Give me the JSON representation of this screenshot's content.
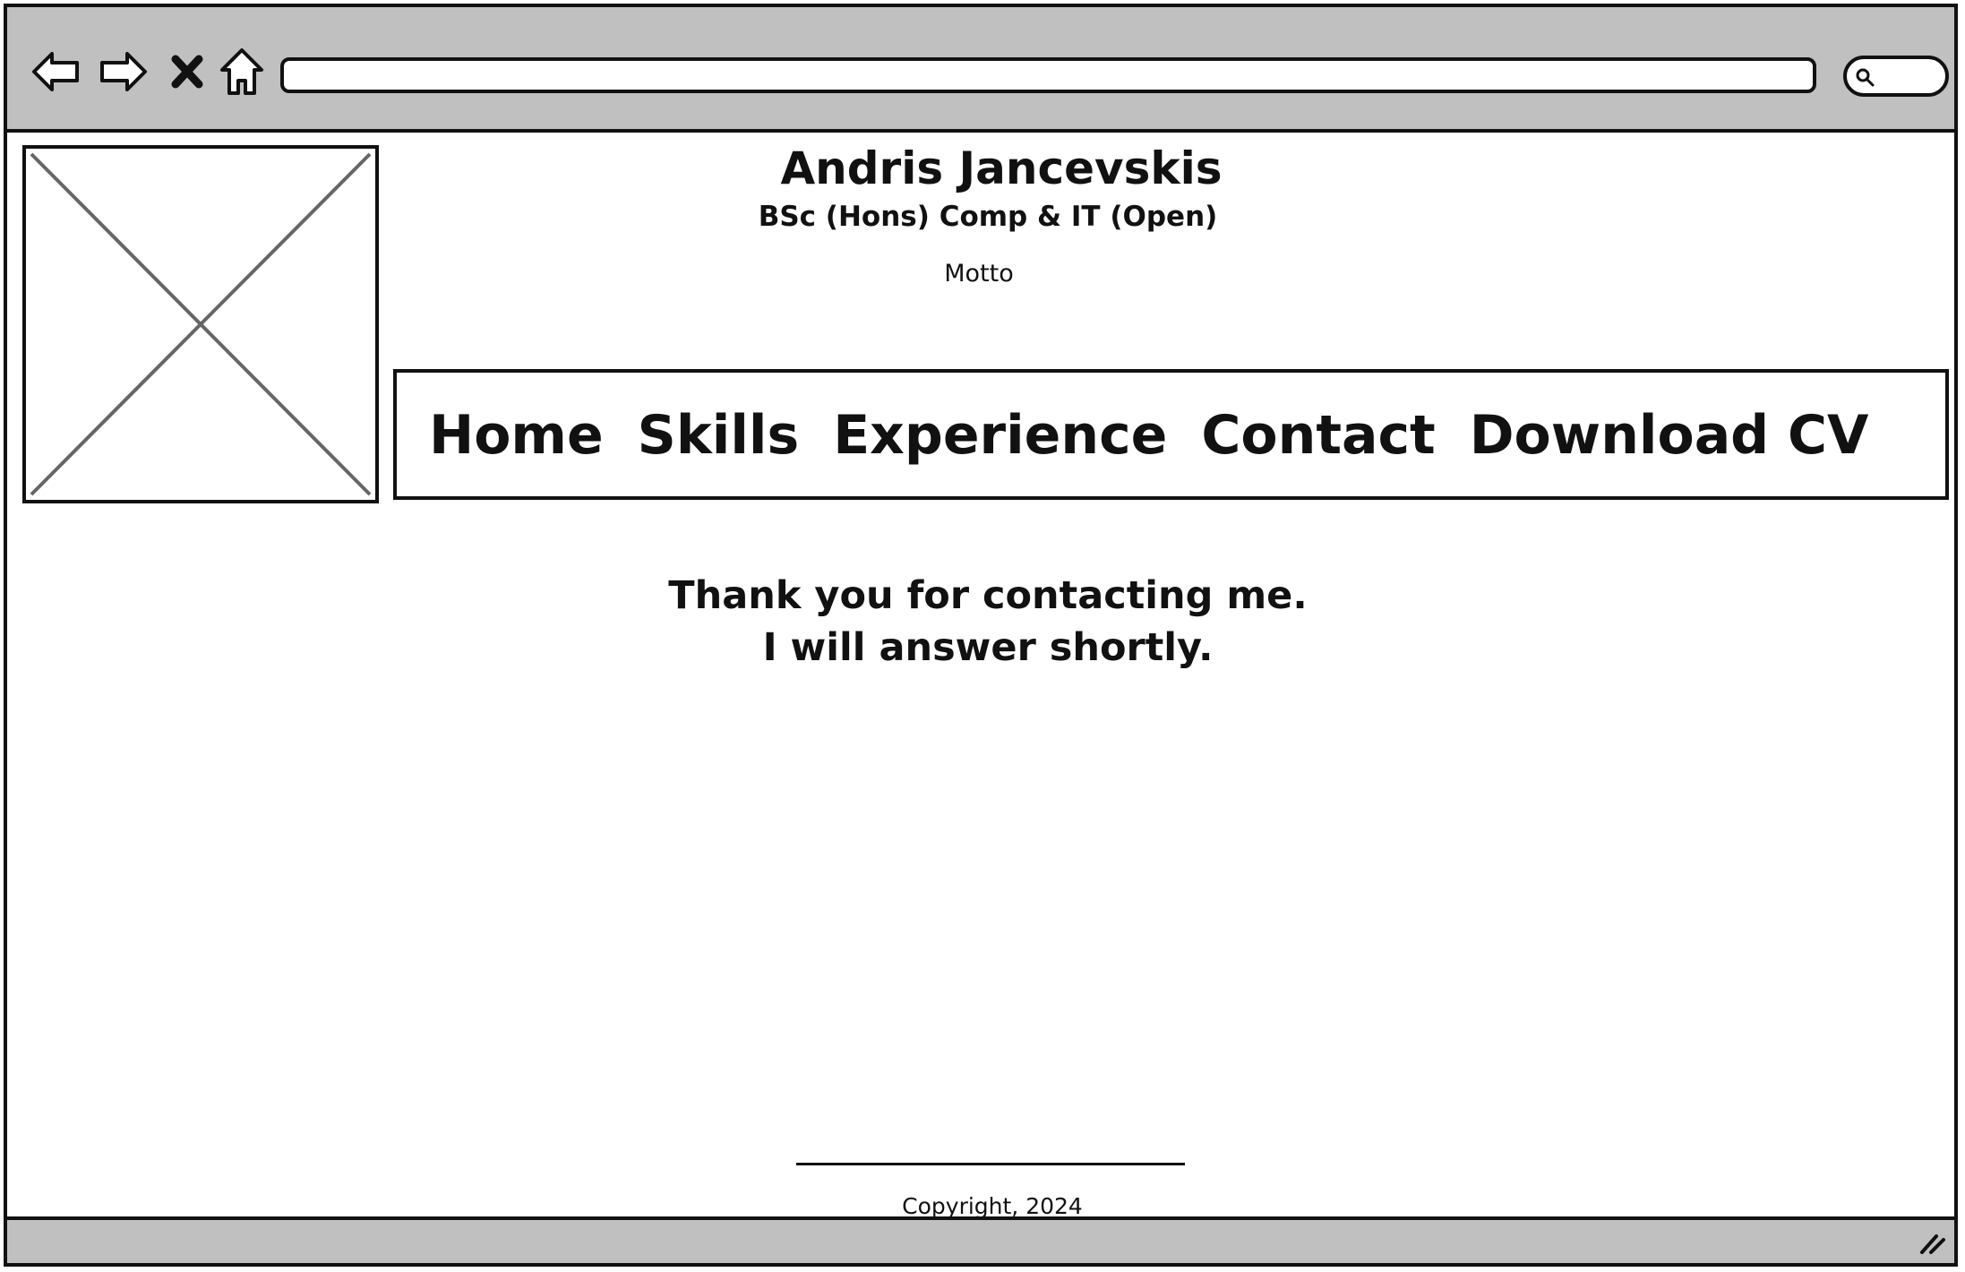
{
  "browser": {
    "back_icon": "back-arrow-icon",
    "forward_icon": "forward-arrow-icon",
    "stop_icon": "close-icon",
    "home_icon": "home-icon",
    "address_value": "",
    "search_icon": "search-icon"
  },
  "header": {
    "name": "Andris Jancevskis",
    "degree": "BSc (Hons) Comp & IT (Open)",
    "motto": "Motto"
  },
  "nav": {
    "items": [
      {
        "label": "Home"
      },
      {
        "label": "Skills"
      },
      {
        "label": "Experience"
      },
      {
        "label": "Contact"
      },
      {
        "label": "Download CV"
      }
    ]
  },
  "main": {
    "message_line1": "Thank you for contacting me.",
    "message_line2": "I will answer shortly."
  },
  "footer": {
    "copyright": "Copyright, 2024"
  },
  "colors": {
    "chrome": "#c0c0c0",
    "ink": "#111111",
    "placeholder_cross": "#666666"
  }
}
